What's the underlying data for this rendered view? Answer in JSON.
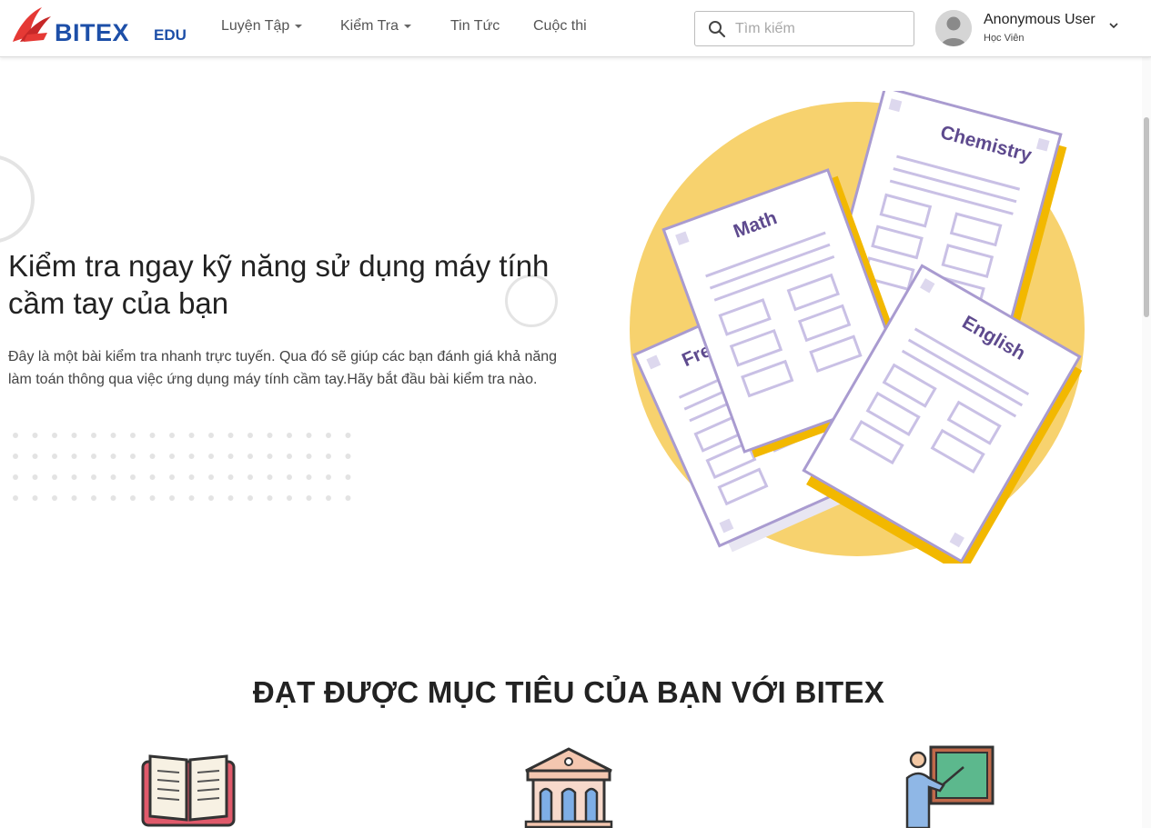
{
  "header": {
    "logo": {
      "brand": "BITEX",
      "sub": "EDU",
      "accent_color": "#e53935",
      "brand_color": "#1d4fa8"
    },
    "nav": [
      {
        "label": "Luyện Tập",
        "dropdown": true
      },
      {
        "label": "Kiểm Tra",
        "dropdown": true
      },
      {
        "label": "Tin Tức",
        "dropdown": false
      },
      {
        "label": "Cuộc thi",
        "dropdown": false
      }
    ],
    "search": {
      "placeholder": "Tìm kiếm",
      "value": ""
    },
    "user": {
      "name": "Anonymous User",
      "role": "Học Viên"
    }
  },
  "hero": {
    "title": "Kiểm tra ngay kỹ năng sử dụng máy tính cầm tay của bạn",
    "description": "Đây là một bài kiểm tra nhanh trực tuyến. Qua đó sẽ giúp các bạn đánh giá khả năng làm toán thông qua việc ứng dụng máy tính cầm tay.Hãy bắt đầu bài kiểm tra nào.",
    "papers": [
      "French",
      "Math",
      "Chemistry",
      "English"
    ],
    "circle_color": "#f7d26e",
    "paper_border_color": "#a99bd0",
    "paper_text_color": "#5e4a8e"
  },
  "section": {
    "title": "ĐẠT ĐƯỢC MỤC TIÊU CỦA BẠN VỚI BITEX",
    "features": [
      {
        "icon": "book-icon"
      },
      {
        "icon": "university-icon"
      },
      {
        "icon": "teacher-board-icon"
      }
    ]
  }
}
